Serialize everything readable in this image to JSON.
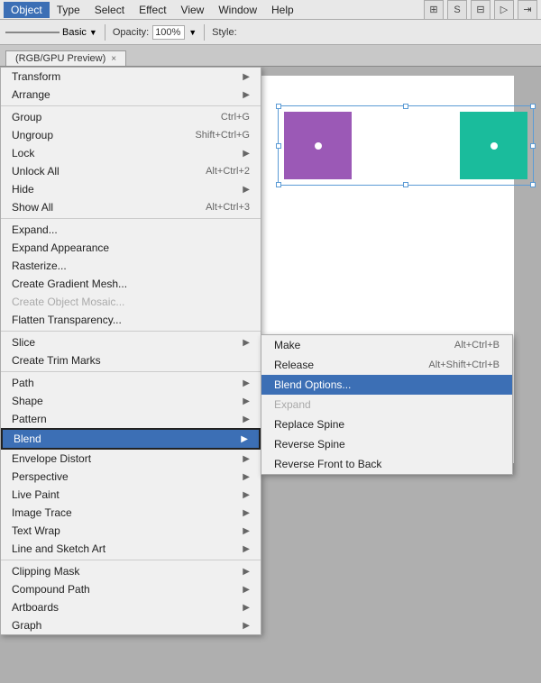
{
  "menubar": {
    "items": [
      "Object",
      "Type",
      "Select",
      "Effect",
      "View",
      "Window",
      "Help"
    ],
    "active": "Object"
  },
  "toolbar": {
    "stroke": "Basic",
    "opacity_label": "Opacity:",
    "opacity_value": "100%",
    "style_label": "Style:"
  },
  "tab": {
    "label": "(RGB/GPU Preview)",
    "close": "×"
  },
  "main_menu": {
    "items": [
      {
        "label": "Transform",
        "shortcut": "",
        "arrow": "▶",
        "disabled": false
      },
      {
        "label": "Arrange",
        "shortcut": "",
        "arrow": "▶",
        "disabled": false
      },
      {
        "label": "",
        "divider": true
      },
      {
        "label": "Group",
        "shortcut": "Ctrl+G",
        "arrow": "",
        "disabled": false
      },
      {
        "label": "Ungroup",
        "shortcut": "Shift+Ctrl+G",
        "arrow": "",
        "disabled": false
      },
      {
        "label": "Lock",
        "shortcut": "",
        "arrow": "▶",
        "disabled": false
      },
      {
        "label": "Unlock All",
        "shortcut": "Alt+Ctrl+2",
        "arrow": "",
        "disabled": false
      },
      {
        "label": "Hide",
        "shortcut": "",
        "arrow": "▶",
        "disabled": false
      },
      {
        "label": "Show All",
        "shortcut": "Alt+Ctrl+3",
        "arrow": "",
        "disabled": false
      },
      {
        "label": "",
        "divider": true
      },
      {
        "label": "Expand...",
        "shortcut": "",
        "arrow": "",
        "disabled": false
      },
      {
        "label": "Expand Appearance",
        "shortcut": "",
        "arrow": "",
        "disabled": false
      },
      {
        "label": "Rasterize...",
        "shortcut": "",
        "arrow": "",
        "disabled": false
      },
      {
        "label": "Create Gradient Mesh...",
        "shortcut": "",
        "arrow": "",
        "disabled": false
      },
      {
        "label": "Create Object Mosaic...",
        "shortcut": "",
        "arrow": "",
        "disabled": true
      },
      {
        "label": "Flatten Transparency...",
        "shortcut": "",
        "arrow": "",
        "disabled": false
      },
      {
        "label": "",
        "divider": true
      },
      {
        "label": "Slice",
        "shortcut": "",
        "arrow": "▶",
        "disabled": false
      },
      {
        "label": "Create Trim Marks",
        "shortcut": "",
        "arrow": "",
        "disabled": false
      },
      {
        "label": "",
        "divider": true
      },
      {
        "label": "Path",
        "shortcut": "",
        "arrow": "▶",
        "disabled": false
      },
      {
        "label": "Shape",
        "shortcut": "",
        "arrow": "▶",
        "disabled": false
      },
      {
        "label": "Pattern",
        "shortcut": "",
        "arrow": "▶",
        "disabled": false
      },
      {
        "label": "Blend",
        "shortcut": "",
        "arrow": "▶",
        "disabled": false,
        "highlighted": true
      },
      {
        "label": "Envelope Distort",
        "shortcut": "",
        "arrow": "▶",
        "disabled": false
      },
      {
        "label": "Perspective",
        "shortcut": "",
        "arrow": "▶",
        "disabled": false
      },
      {
        "label": "Live Paint",
        "shortcut": "",
        "arrow": "▶",
        "disabled": false
      },
      {
        "label": "Image Trace",
        "shortcut": "",
        "arrow": "▶",
        "disabled": false
      },
      {
        "label": "Text Wrap",
        "shortcut": "",
        "arrow": "▶",
        "disabled": false
      },
      {
        "label": "Line and Sketch Art",
        "shortcut": "",
        "arrow": "▶",
        "disabled": false
      },
      {
        "label": "",
        "divider": true
      },
      {
        "label": "Clipping Mask",
        "shortcut": "",
        "arrow": "▶",
        "disabled": false
      },
      {
        "label": "Compound Path",
        "shortcut": "",
        "arrow": "▶",
        "disabled": false
      },
      {
        "label": "Artboards",
        "shortcut": "",
        "arrow": "▶",
        "disabled": false
      },
      {
        "label": "Graph",
        "shortcut": "",
        "arrow": "▶",
        "disabled": false
      }
    ]
  },
  "submenu": {
    "items": [
      {
        "label": "Make",
        "shortcut": "Alt+Ctrl+B",
        "active": false
      },
      {
        "label": "Release",
        "shortcut": "Alt+Shift+Ctrl+B",
        "active": false
      },
      {
        "label": "Blend Options...",
        "shortcut": "",
        "active": true
      },
      {
        "label": "Expand",
        "shortcut": "",
        "active": false,
        "disabled": true
      },
      {
        "label": "Replace Spine",
        "shortcut": "",
        "active": false
      },
      {
        "label": "Reverse Spine",
        "shortcut": "",
        "active": false
      },
      {
        "label": "Reverse Front to Back",
        "shortcut": "",
        "active": false
      }
    ]
  }
}
